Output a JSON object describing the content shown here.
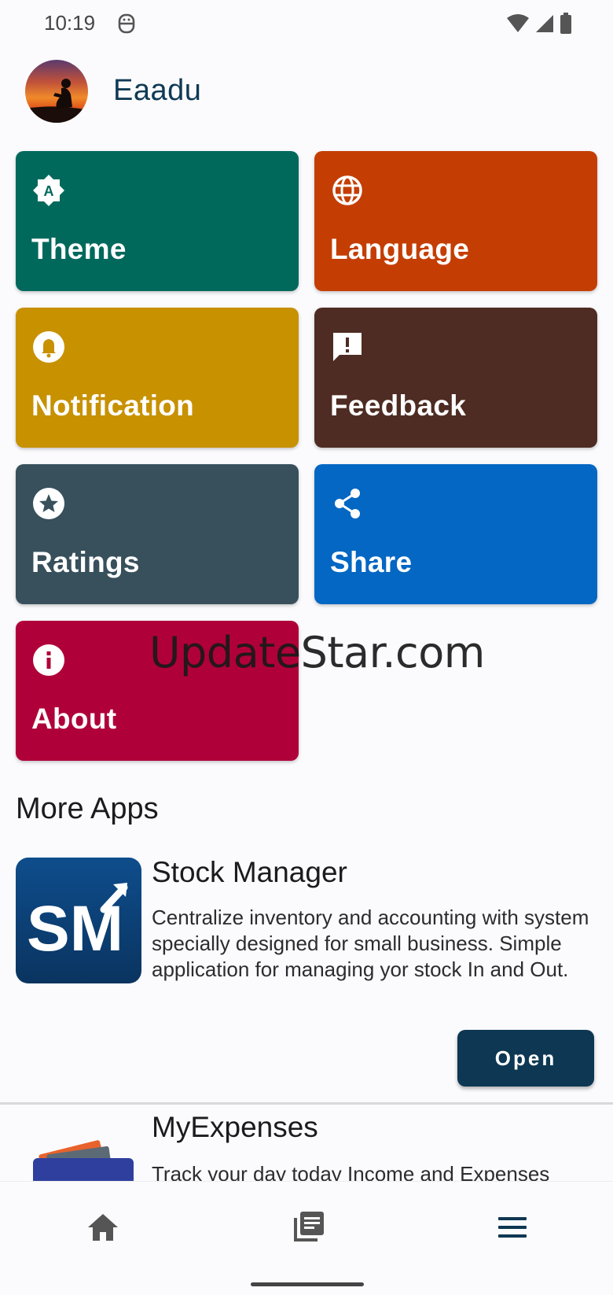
{
  "status": {
    "time": "10:19"
  },
  "header": {
    "title": "Eaadu"
  },
  "tiles": [
    {
      "label": "Theme",
      "color": "#00695c",
      "icon": "brightness-auto-icon"
    },
    {
      "label": "Language",
      "color": "#c43e04",
      "icon": "globe-icon"
    },
    {
      "label": "Notification",
      "color": "#c79100",
      "icon": "bell-icon"
    },
    {
      "label": "Feedback",
      "color": "#4e2c23",
      "icon": "feedback-icon"
    },
    {
      "label": "Ratings",
      "color": "#37505c",
      "icon": "star-icon"
    },
    {
      "label": "Share",
      "color": "#0367c3",
      "icon": "share-icon"
    },
    {
      "label": "About",
      "color": "#b0003a",
      "icon": "info-icon"
    }
  ],
  "watermark": "UpdateStar.com",
  "more_apps": {
    "title": "More Apps",
    "apps": [
      {
        "name": "Stock Manager",
        "logo_text": "SM",
        "description": "Centralize inventory and accounting with system specially designed for small business. Simple application for managing yor stock In and Out.",
        "button": "Open"
      },
      {
        "name": "MyExpenses",
        "description": "Track your day today Income and Expenses"
      }
    ]
  },
  "nav": {
    "items": [
      "home-icon",
      "library-books-icon",
      "menu-icon"
    ],
    "active_color": "#0d3752",
    "inactive_color": "#555555"
  }
}
